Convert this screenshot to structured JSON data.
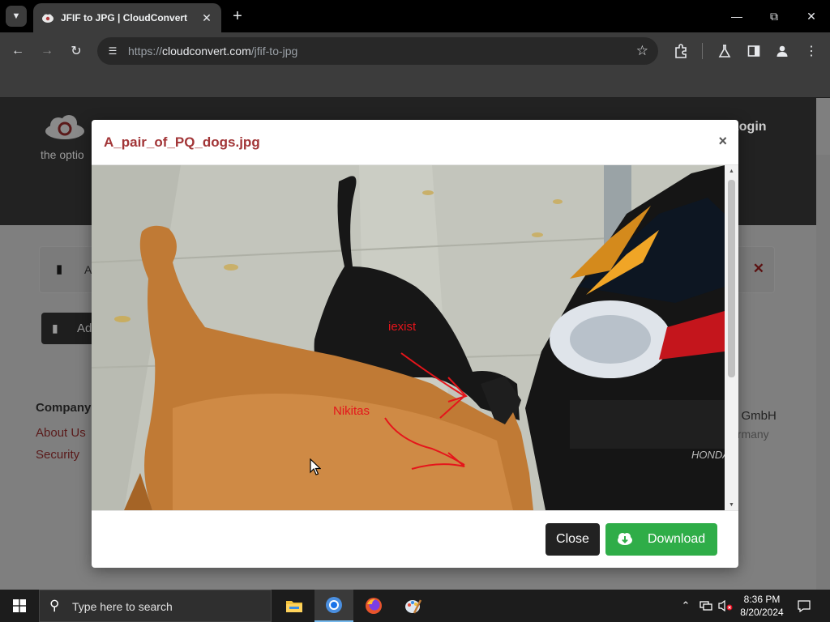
{
  "browser": {
    "tab_title": "JFIF to JPG | CloudConvert",
    "url_scheme": "https://",
    "url_host": "cloudconvert.com",
    "url_path": "/jfif-to-jpg",
    "tab_search_icon": "chevron-down-icon",
    "new_tab_glyph": "+",
    "tab_close_glyph": "✕"
  },
  "page": {
    "login_label": "Login",
    "header_fragment": "the optio",
    "file_row_name": "A",
    "add_files_label": "Ad",
    "footer": {
      "heading": "Company",
      "links": [
        "About Us",
        "Security"
      ],
      "right_line1": "o GmbH",
      "right_line2": "ermany"
    }
  },
  "modal": {
    "title": "A_pair_of_PQ_dogs.jpg",
    "close_glyph": "×",
    "annotations": [
      "iexist",
      "Nikitas"
    ],
    "close_label": "Close",
    "download_label": "Download",
    "accent_color": "#a23537",
    "download_color": "#2fad48"
  },
  "taskbar": {
    "search_placeholder": "Type here to search",
    "time": "8:36 PM",
    "date": "8/20/2024",
    "apps": [
      "file-explorer-icon",
      "chrome-icon",
      "firefox-icon",
      "paint-icon"
    ]
  }
}
